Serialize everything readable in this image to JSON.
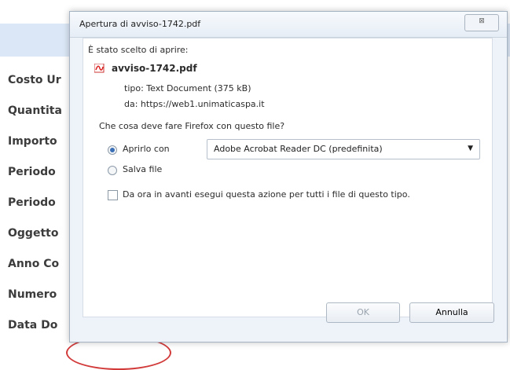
{
  "background": {
    "labels": [
      "Costo Ur",
      "Quantita",
      "Importo",
      "Periodo",
      "Periodo",
      "Oggetto",
      "Anno Co",
      "Numero",
      "Data Do"
    ]
  },
  "dialog": {
    "title": "Apertura di avviso-1742.pdf",
    "close_glyph": "⊠",
    "intro": "È stato scelto di aprire:",
    "file_name": "avviso-1742.pdf",
    "type_line": "tipo:  Text Document (375 kB)",
    "from_line": "da:  https://web1.unimaticaspa.it",
    "question": "Che cosa deve fare Firefox con questo file?",
    "open_with_label": "Aprirlo con",
    "open_with_app": "Adobe Acrobat Reader DC  (predefinita)",
    "save_label": "Salva file",
    "remember_label": "Da ora in avanti esegui questa azione per tutti i file di questo tipo.",
    "ok_label": "OK",
    "cancel_label": "Annulla"
  }
}
